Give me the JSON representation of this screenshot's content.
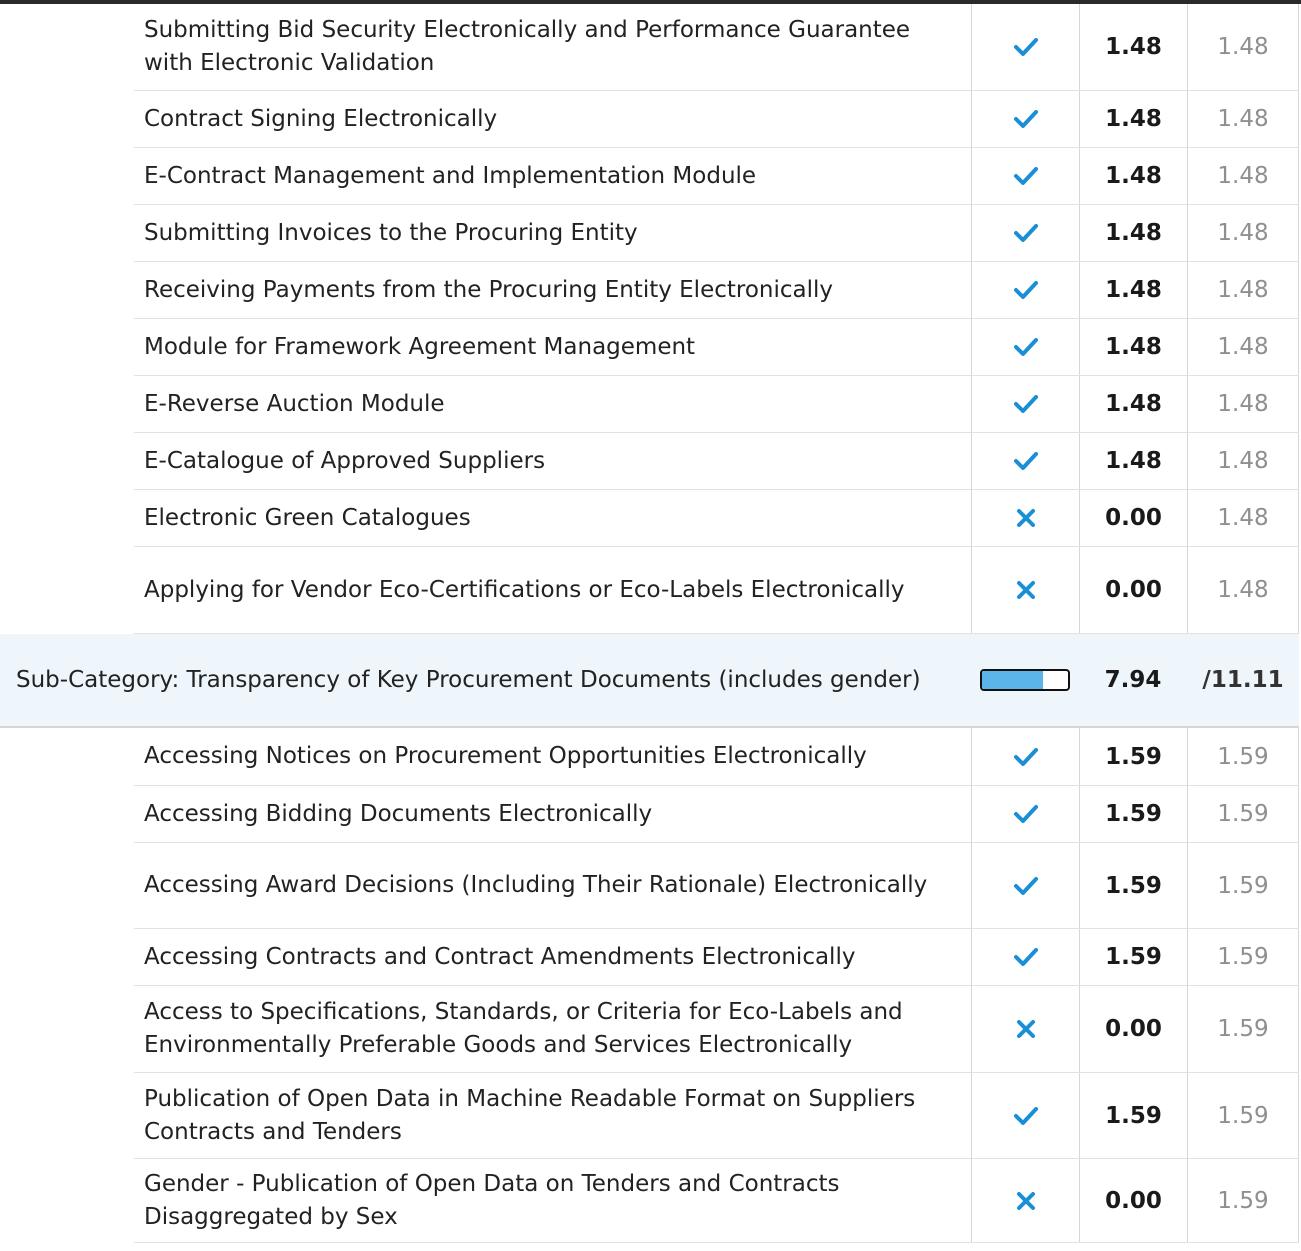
{
  "colors": {
    "check": "#1a8fd6",
    "cross": "#1a8fd6",
    "progress_fill": "#5bb5e9",
    "subcategory_bg": "#eef6fc"
  },
  "group1_items": [
    {
      "label": "Submitting Bid Security Electronically and Performance Guarantee with Electronic Validation",
      "status": "check",
      "score": "1.48",
      "max": "1.48"
    },
    {
      "label": "Contract Signing Electronically",
      "status": "check",
      "score": "1.48",
      "max": "1.48"
    },
    {
      "label": "E-Contract Management and Implementation Module",
      "status": "check",
      "score": "1.48",
      "max": "1.48"
    },
    {
      "label": "Submitting Invoices to the Procuring Entity",
      "status": "check",
      "score": "1.48",
      "max": "1.48"
    },
    {
      "label": "Receiving Payments from the Procuring Entity Electronically",
      "status": "check",
      "score": "1.48",
      "max": "1.48"
    },
    {
      "label": "Module for Framework Agreement Management",
      "status": "check",
      "score": "1.48",
      "max": "1.48"
    },
    {
      "label": "E-Reverse Auction Module",
      "status": "check",
      "score": "1.48",
      "max": "1.48"
    },
    {
      "label": "E-Catalogue of Approved Suppliers",
      "status": "check",
      "score": "1.48",
      "max": "1.48"
    },
    {
      "label": "Electronic Green Catalogues",
      "status": "cross",
      "score": "0.00",
      "max": "1.48"
    },
    {
      "label": "Applying for Vendor Eco-Certifications or Eco-Labels Electronically",
      "status": "cross",
      "score": "0.00",
      "max": "1.48"
    }
  ],
  "subcategory": {
    "label": "Sub-Category: Transparency of Key Procurement Documents (includes gender)",
    "score": "7.94",
    "max": "/11.11",
    "progress": 0.7147
  },
  "group2_items": [
    {
      "label": "Accessing Notices on Procurement Opportunities Electronically",
      "status": "check",
      "score": "1.59",
      "max": "1.59"
    },
    {
      "label": "Accessing Bidding Documents Electronically",
      "status": "check",
      "score": "1.59",
      "max": "1.59"
    },
    {
      "label": "Accessing Award Decisions (Including Their Rationale) Electronically",
      "status": "check",
      "score": "1.59",
      "max": "1.59"
    },
    {
      "label": "Accessing Contracts and Contract Amendments Electronically",
      "status": "check",
      "score": "1.59",
      "max": "1.59"
    },
    {
      "label": "Access to Specifications, Standards, or Criteria for Eco-Labels and Environmentally Preferable Goods and Services Electronically",
      "status": "cross",
      "score": "0.00",
      "max": "1.59"
    },
    {
      "label": "Publication of Open Data in Machine Readable Format on Suppliers Contracts and Tenders",
      "status": "check",
      "score": "1.59",
      "max": "1.59"
    },
    {
      "label": "Gender - Publication of Open Data on Tenders and Contracts Disaggregated by Sex",
      "status": "cross",
      "score": "0.00",
      "max": "1.59"
    }
  ]
}
